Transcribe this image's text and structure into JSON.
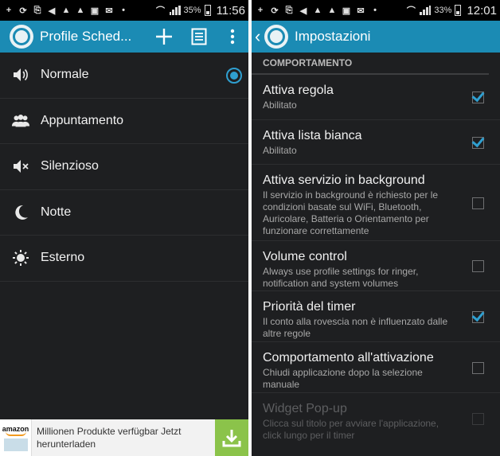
{
  "left": {
    "status": {
      "battery": "35%",
      "time": "11:56"
    },
    "actionbar": {
      "title": "Profile Sched..."
    },
    "profiles": [
      {
        "label": "Normale",
        "icon": "speaker-icon",
        "selected": true
      },
      {
        "label": "Appuntamento",
        "icon": "people-icon",
        "selected": false
      },
      {
        "label": "Silenzioso",
        "icon": "speaker-mute-icon",
        "selected": false
      },
      {
        "label": "Notte",
        "icon": "moon-icon",
        "selected": false
      },
      {
        "label": "Esterno",
        "icon": "sun-icon",
        "selected": false
      }
    ],
    "ad": {
      "logo": "amazon",
      "text": "Millionen Produkte verfügbar Jetzt herunterladen"
    }
  },
  "right": {
    "status": {
      "battery": "33%",
      "time": "12:01"
    },
    "actionbar": {
      "title": "Impostazioni"
    },
    "section": "COMPORTAMENTO",
    "prefs": [
      {
        "title": "Attiva regola",
        "summary": "Abilitato",
        "checked": true,
        "enabled": true
      },
      {
        "title": "Attiva lista bianca",
        "summary": "Abilitato",
        "checked": true,
        "enabled": true
      },
      {
        "title": "Attiva servizio in background",
        "summary": "Il servizio in background è richiesto per le condizioni basate sul WiFi, Bluetooth, Auricolare, Batteria o Orientamento per funzionare correttamente",
        "checked": false,
        "enabled": true
      },
      {
        "title": "Volume control",
        "summary": "Always use profile settings for ringer, notification and system volumes",
        "checked": false,
        "enabled": true
      },
      {
        "title": "Priorità del timer",
        "summary": "Il conto alla rovescia non è influenzato dalle altre regole",
        "checked": true,
        "enabled": true
      },
      {
        "title": "Comportamento all'attivazione",
        "summary": "Chiudi applicazione dopo la selezione manuale",
        "checked": false,
        "enabled": true
      },
      {
        "title": "Widget Pop-up",
        "summary": "Clicca sul titolo per avviare l'applicazione, click lungo per il timer",
        "checked": false,
        "enabled": false
      }
    ]
  },
  "colors": {
    "accent": "#1b8bb4",
    "check": "#2f9fd0",
    "background": "#1e1f21",
    "ad_download": "#8bc34a"
  }
}
